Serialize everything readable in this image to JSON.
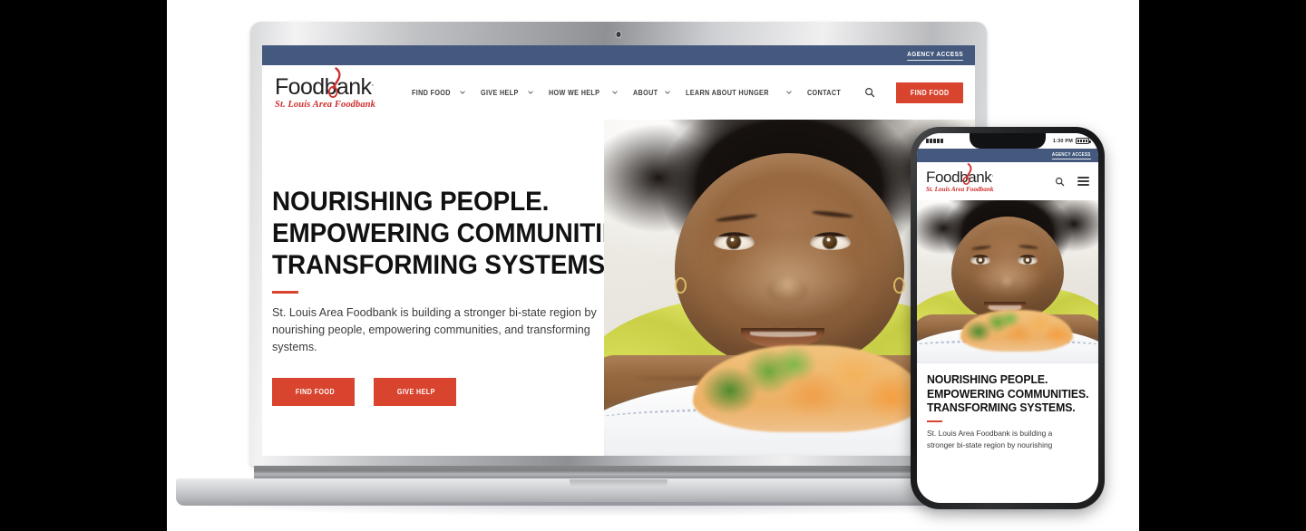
{
  "topbar": {
    "agency_access": "AGENCY ACCESS"
  },
  "brand": {
    "wordmark": "Foodbank",
    "wordmark_dot": ".",
    "tagline": "St. Louis Area Foodbank",
    "accent_red": "#d9442f",
    "navy": "#44597d"
  },
  "nav": {
    "items": [
      {
        "label": "FIND FOOD",
        "has_dropdown": true
      },
      {
        "label": "GIVE HELP",
        "has_dropdown": true
      },
      {
        "label": "HOW WE HELP",
        "has_dropdown": true
      },
      {
        "label": "ABOUT",
        "has_dropdown": true
      },
      {
        "label": "LEARN ABOUT HUNGER",
        "has_dropdown": true
      },
      {
        "label": "CONTACT",
        "has_dropdown": false
      }
    ],
    "search_icon": "search-icon",
    "cta_label": "FIND FOOD"
  },
  "hero": {
    "headline_line1": "NOURISHING PEOPLE.",
    "headline_line2": "EMPOWERING COMMUNITIES.",
    "headline_line3": "TRANSFORMING SYSTEMS.",
    "body": "St. Louis Area Foodbank is building a stronger bi-state region by nourishing people, empowering communities, and transforming systems.",
    "buttons": [
      {
        "label": "FIND FOOD"
      },
      {
        "label": "GIVE HELP"
      }
    ],
    "image_alt": "Smiling young girl in a yellow shirt resting her arms on a table behind a plate of vegetables"
  },
  "phone": {
    "status": {
      "time": "1:30 PM"
    },
    "agency_access": "AGENCY ACCESS",
    "search_icon": "search-icon",
    "menu_icon": "hamburger-menu-icon",
    "headline_line1": "NOURISHING PEOPLE.",
    "headline_line2": "EMPOWERING COMMUNITIES.",
    "headline_line3": "TRANSFORMING SYSTEMS.",
    "body_line1": "St. Louis Area Foodbank is building a",
    "body_line2": "stronger bi-state region by nourishing"
  }
}
